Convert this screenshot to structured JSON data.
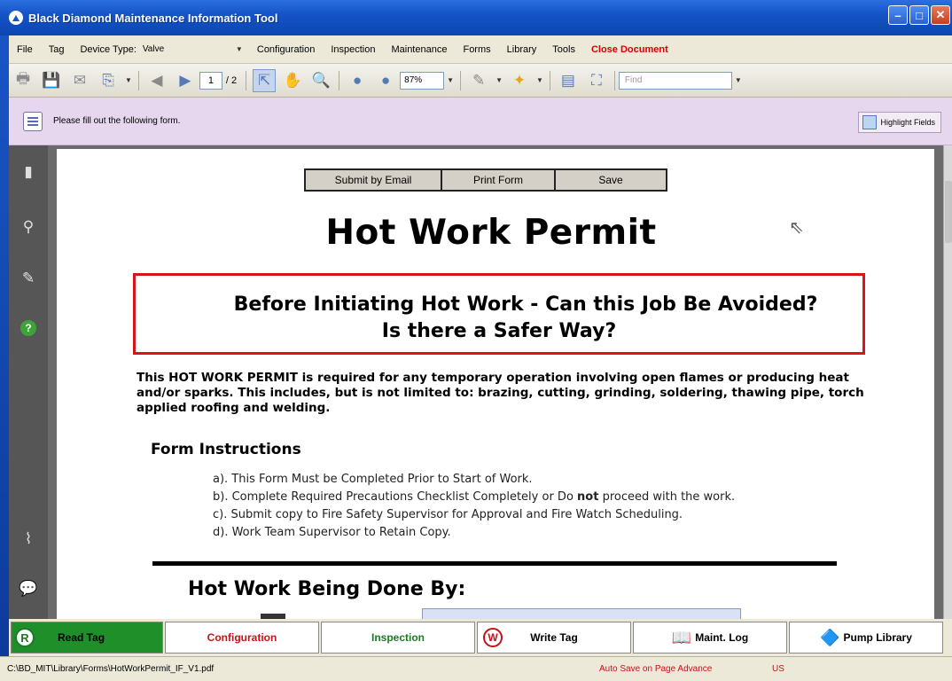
{
  "window": {
    "title": "Black Diamond Maintenance Information Tool"
  },
  "menubar": {
    "items": [
      "File",
      "Tag",
      "Device Type:"
    ],
    "device_type_value": "Valve",
    "items_after": [
      "Configuration",
      "Inspection",
      "Maintenance",
      "Forms",
      "Library",
      "Tools"
    ],
    "close_document": "Close Document"
  },
  "toolbar": {
    "page_current": "1",
    "page_total": "/ 2",
    "zoom": "87%",
    "find_placeholder": "Find"
  },
  "formbar": {
    "message": "Please fill out the following form.",
    "highlight_label": "Highlight Fields"
  },
  "document": {
    "buttons": [
      "Submit by Email",
      "Print Form",
      "Save"
    ],
    "title": "Hot Work Permit",
    "warning_line1": "Before Initiating Hot Work - Can this Job Be Avoided?",
    "warning_line2": "Is there a Safer Way?",
    "intro": "This HOT WORK PERMIT is required for any temporary operation involving open flames or producing heat and/or sparks. This includes, but is not limited to: brazing, cutting, grinding, soldering, thawing pipe, torch applied roofing and welding.",
    "instructions_title": "Form Instructions",
    "instructions": {
      "a": "a). This Form Must be Completed Prior to Start of Work.",
      "b_pre": "b). Complete Required Precautions Checklist Completely or Do ",
      "b_bold": "not",
      "b_post": " proceed with the work.",
      "c": "c). Submit copy to Fire Safety Supervisor for Approval and Fire Watch Scheduling.",
      "d": "d). Work Team Supervisor to Retain Copy."
    },
    "done_by_title": "Hot Work Being Done By:"
  },
  "bottombar": {
    "read_tag": "Read Tag",
    "configuration": "Configuration",
    "inspection": "Inspection",
    "write_tag": "Write Tag",
    "maint_log": "Maint. Log",
    "pump_library": "Pump Library"
  },
  "statusbar": {
    "path": "C:\\BD_MIT\\Library\\Forms\\HotWorkPermit_IF_V1.pdf",
    "auto_save": "Auto Save on Page Advance",
    "locale": "US"
  },
  "colors": {
    "accent": "#1554c8",
    "close_red": "#d00000",
    "read_green": "#1f8f2a",
    "form_bar": "#e6d7ef"
  },
  "icons": [
    "print-icon",
    "save-icon",
    "email-icon",
    "attach-icon",
    "prev-page-icon",
    "next-page-icon",
    "select-tool-icon",
    "hand-tool-icon",
    "zoom-icon",
    "zoom-out-icon",
    "zoom-in-icon",
    "pen-icon",
    "stamp-icon",
    "fit-page-icon",
    "fullscreen-icon"
  ]
}
